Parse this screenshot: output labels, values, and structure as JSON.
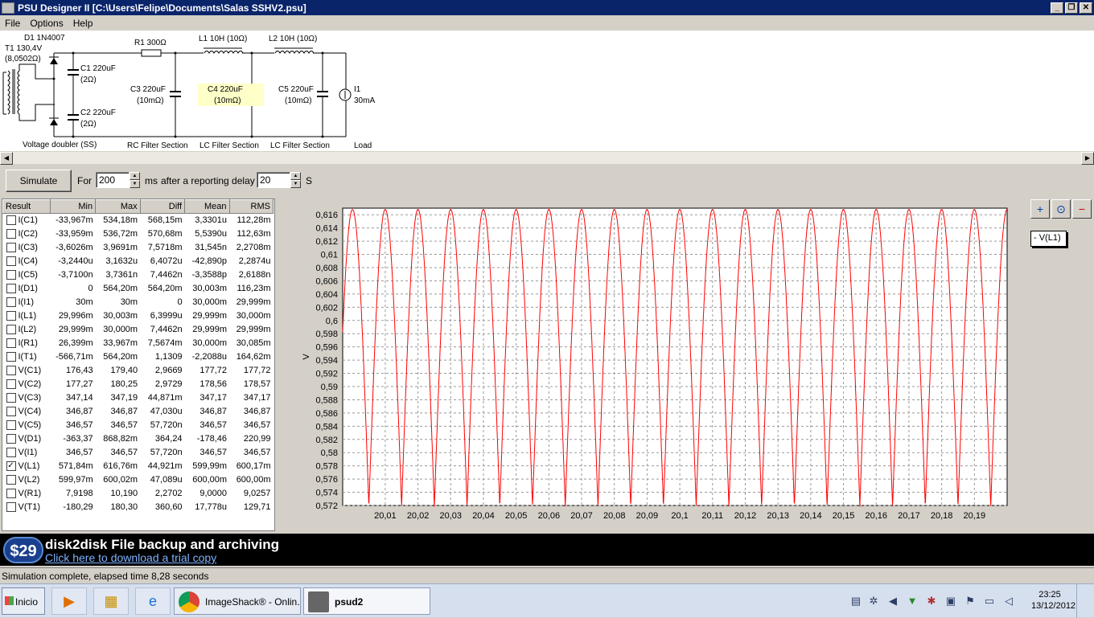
{
  "window": {
    "title": "PSU Designer II  [C:\\Users\\Felipe\\Documents\\Salas SSHV2.psu]",
    "buttons": {
      "minimize": "_",
      "maximize": "❐",
      "close": "✕"
    }
  },
  "menu": [
    "File",
    "Options",
    "Help"
  ],
  "schematic": {
    "d1": "D1 1N4007",
    "t1": "T1 130,4V",
    "t1_r": "(8,0502Ω)",
    "c1": "C1 220uF",
    "c1_r": "(2Ω)",
    "c2": "C2 220uF",
    "c2_r": "(2Ω)",
    "r1": "R1 300Ω",
    "l1": "L1 10H (10Ω)",
    "l2": "L2 10H (10Ω)",
    "c3": "C3 220uF",
    "c3_r": "(10mΩ)",
    "c4": "C4 220uF",
    "c4_r": "(10mΩ)",
    "c5": "C5 220uF",
    "c5_r": "(10mΩ)",
    "i1": "I1",
    "i1_v": "30mA",
    "sec_vd": "Voltage doubler (SS)",
    "sec_rc": "RC Filter Section",
    "sec_lc1": "LC Filter Section",
    "sec_lc2": "LC Filter Section",
    "sec_load": "Load"
  },
  "controls": {
    "simulate": "Simulate",
    "for": "For",
    "for_value": "200",
    "ms": "ms",
    "after": "after a reporting delay of",
    "delay_value": "20",
    "s": "S"
  },
  "results": {
    "headers": [
      "Result",
      "Min",
      "Max",
      "Diff",
      "Mean",
      "RMS"
    ],
    "rows": [
      {
        "name": "I(C1)",
        "checked": false,
        "v": [
          "-33,967m",
          "534,18m",
          "568,15m",
          "3,3301u",
          "112,28m"
        ]
      },
      {
        "name": "I(C2)",
        "checked": false,
        "v": [
          "-33,959m",
          "536,72m",
          "570,68m",
          "5,5390u",
          "112,63m"
        ]
      },
      {
        "name": "I(C3)",
        "checked": false,
        "v": [
          "-3,6026m",
          "3,9691m",
          "7,5718m",
          "31,545n",
          "2,2708m"
        ]
      },
      {
        "name": "I(C4)",
        "checked": false,
        "v": [
          "-3,2440u",
          "3,1632u",
          "6,4072u",
          "-42,890p",
          "2,2874u"
        ]
      },
      {
        "name": "I(C5)",
        "checked": false,
        "v": [
          "-3,7100n",
          "3,7361n",
          "7,4462n",
          "-3,3588p",
          "2,6188n"
        ]
      },
      {
        "name": "I(D1)",
        "checked": false,
        "v": [
          "0",
          "564,20m",
          "564,20m",
          "30,003m",
          "116,23m"
        ]
      },
      {
        "name": "I(I1)",
        "checked": false,
        "v": [
          "30m",
          "30m",
          "0",
          "30,000m",
          "29,999m"
        ]
      },
      {
        "name": "I(L1)",
        "checked": false,
        "v": [
          "29,996m",
          "30,003m",
          "6,3999u",
          "29,999m",
          "30,000m"
        ]
      },
      {
        "name": "I(L2)",
        "checked": false,
        "v": [
          "29,999m",
          "30,000m",
          "7,4462n",
          "29,999m",
          "29,999m"
        ]
      },
      {
        "name": "I(R1)",
        "checked": false,
        "v": [
          "26,399m",
          "33,967m",
          "7,5674m",
          "30,000m",
          "30,085m"
        ]
      },
      {
        "name": "I(T1)",
        "checked": false,
        "v": [
          "-566,71m",
          "564,20m",
          "1,1309",
          "-2,2088u",
          "164,62m"
        ]
      },
      {
        "name": "V(C1)",
        "checked": false,
        "v": [
          "176,43",
          "179,40",
          "2,9669",
          "177,72",
          "177,72"
        ]
      },
      {
        "name": "V(C2)",
        "checked": false,
        "v": [
          "177,27",
          "180,25",
          "2,9729",
          "178,56",
          "178,57"
        ]
      },
      {
        "name": "V(C3)",
        "checked": false,
        "v": [
          "347,14",
          "347,19",
          "44,871m",
          "347,17",
          "347,17"
        ]
      },
      {
        "name": "V(C4)",
        "checked": false,
        "v": [
          "346,87",
          "346,87",
          "47,030u",
          "346,87",
          "346,87"
        ]
      },
      {
        "name": "V(C5)",
        "checked": false,
        "v": [
          "346,57",
          "346,57",
          "57,720n",
          "346,57",
          "346,57"
        ]
      },
      {
        "name": "V(D1)",
        "checked": false,
        "v": [
          "-363,37",
          "868,82m",
          "364,24",
          "-178,46",
          "220,99"
        ]
      },
      {
        "name": "V(I1)",
        "checked": false,
        "v": [
          "346,57",
          "346,57",
          "57,720n",
          "346,57",
          "346,57"
        ]
      },
      {
        "name": "V(L1)",
        "checked": true,
        "v": [
          "571,84m",
          "616,76m",
          "44,921m",
          "599,99m",
          "600,17m"
        ]
      },
      {
        "name": "V(L2)",
        "checked": false,
        "v": [
          "599,97m",
          "600,02m",
          "47,089u",
          "600,00m",
          "600,00m"
        ]
      },
      {
        "name": "V(R1)",
        "checked": false,
        "v": [
          "7,9198",
          "10,190",
          "2,2702",
          "9,0000",
          "9,0257"
        ]
      },
      {
        "name": "V(T1)",
        "checked": false,
        "v": [
          "-180,29",
          "180,30",
          "360,60",
          "17,778u",
          "129,71"
        ]
      }
    ]
  },
  "chart_data": {
    "type": "line",
    "ylabel": "V",
    "ylim": [
      0.572,
      0.617
    ],
    "xlim": [
      19.997,
      20.2
    ],
    "yticks": [
      "0,572",
      "0,574",
      "0,576",
      "0,578",
      "0,58",
      "0,582",
      "0,584",
      "0,586",
      "0,588",
      "0,59",
      "0,592",
      "0,594",
      "0,596",
      "0,598",
      "0,6",
      "0,602",
      "0,604",
      "0,606",
      "0,608",
      "0,61",
      "0,612",
      "0,614",
      "0,616"
    ],
    "xticks": [
      "20,01",
      "20,02",
      "20,03",
      "20,04",
      "20,05",
      "20,06",
      "20,07",
      "20,08",
      "20,09",
      "20,1",
      "20,11",
      "20,12",
      "20,13",
      "20,14",
      "20,15",
      "20,16",
      "20,17",
      "20,18",
      "20,19"
    ],
    "series": [
      {
        "name": "V(L1)",
        "color": "#ff0000",
        "min": 0.5718,
        "max": 0.6168,
        "period": 0.01,
        "phase_peak": 20.0
      }
    ],
    "grid": true,
    "legend_position": "right"
  },
  "zoom": {
    "in": "+",
    "fit": "⊙",
    "out": "−"
  },
  "legend_label": "- V(L1)",
  "banner": {
    "price": "$29",
    "line1": "disk2disk File backup and archiving",
    "line2": "Click here to download a trial copy"
  },
  "status": "Simulation complete, elapsed time 8,28 seconds",
  "taskbar": {
    "start": "Inicio",
    "tasks": [
      "ImageShack® - Onlin...",
      "psud2"
    ],
    "time": "23:25",
    "date": "13/12/2012"
  }
}
